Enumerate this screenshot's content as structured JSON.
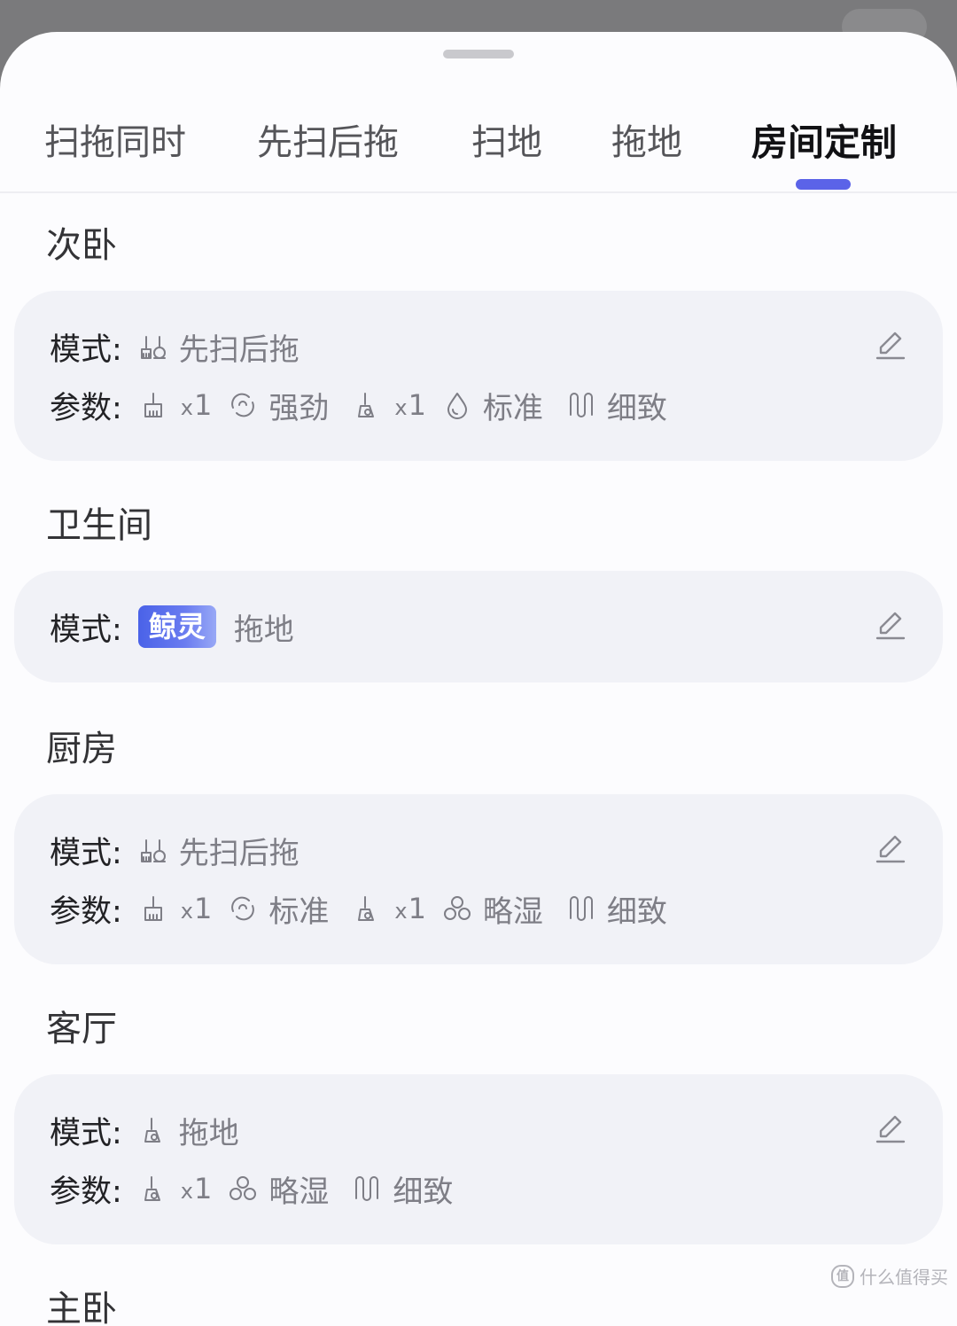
{
  "tabs": [
    {
      "label": "扫拖同时",
      "active": false
    },
    {
      "label": "先扫后拖",
      "active": false
    },
    {
      "label": "扫地",
      "active": false
    },
    {
      "label": "拖地",
      "active": false
    },
    {
      "label": "房间定制",
      "active": true
    }
  ],
  "labels": {
    "mode": "模式:",
    "params": "参数:"
  },
  "rooms": [
    {
      "name": "次卧",
      "mode_icon": "sweep-mop-icon",
      "mode": "先扫后拖",
      "params": {
        "sweep_count_prefix": "x",
        "sweep_count": "1",
        "suction": "强劲",
        "mop_count_prefix": "x",
        "mop_count": "1",
        "water": "标准",
        "route": "细致"
      }
    },
    {
      "name": "卫生间",
      "mode_badge": "鲸灵",
      "mode": "拖地"
    },
    {
      "name": "厨房",
      "mode_icon": "sweep-mop-icon",
      "mode": "先扫后拖",
      "params": {
        "sweep_count_prefix": "x",
        "sweep_count": "1",
        "suction": "标准",
        "mop_count_prefix": "x",
        "mop_count": "1",
        "water": "略湿",
        "route": "细致"
      }
    },
    {
      "name": "客厅",
      "mode_icon": "mop-icon",
      "mode": "拖地",
      "params": {
        "mop_count_prefix": "x",
        "mop_count": "1",
        "water": "略湿",
        "route": "细致"
      }
    },
    {
      "name": "主卧"
    }
  ],
  "watermark": {
    "badge": "值",
    "text": "什么值得买"
  },
  "colors": {
    "accent": "#5b63e8",
    "card_bg": "#f1f2f7",
    "badge_gradient_start": "#4a62e8"
  }
}
